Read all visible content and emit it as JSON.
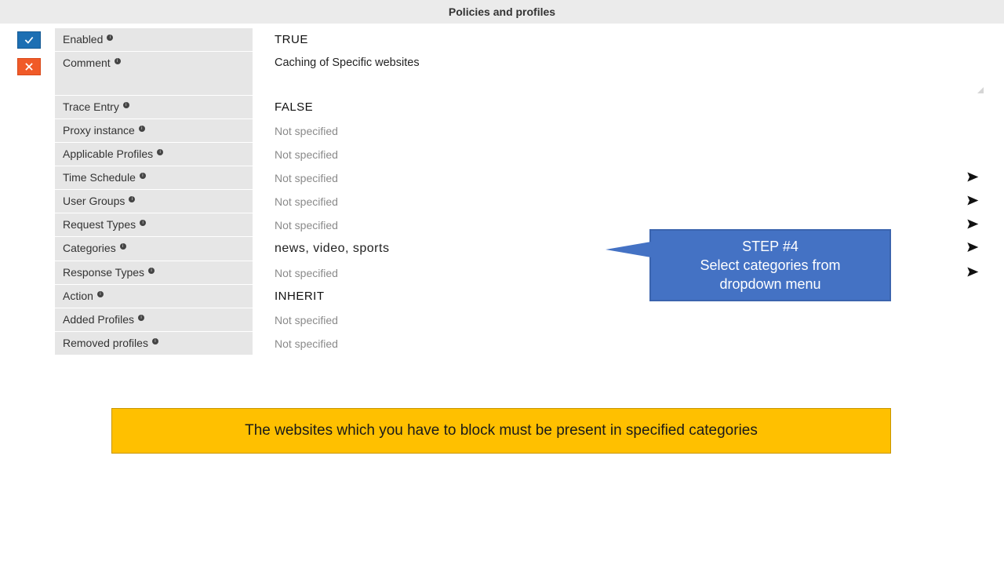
{
  "header": {
    "title": "Policies and profiles"
  },
  "sideIcons": {
    "save": "checkbox-icon",
    "cancel": "close-icon"
  },
  "rows": {
    "enabled": {
      "label": "Enabled",
      "value": "TRUE"
    },
    "comment": {
      "label": "Comment",
      "value": "Caching of Specific websites"
    },
    "traceEntry": {
      "label": "Trace Entry",
      "value": "FALSE"
    },
    "proxyInstance": {
      "label": "Proxy instance",
      "value": "Not specified"
    },
    "applicableProfiles": {
      "label": "Applicable Profiles",
      "value": "Not specified"
    },
    "timeSchedule": {
      "label": "Time Schedule",
      "value": "Not specified"
    },
    "userGroups": {
      "label": "User Groups",
      "value": "Not specified"
    },
    "requestTypes": {
      "label": "Request Types",
      "value": "Not specified"
    },
    "categories": {
      "label": "Categories",
      "value": "news,   video,   sports"
    },
    "responseTypes": {
      "label": "Response Types",
      "value": "Not specified"
    },
    "action": {
      "label": "Action",
      "value": "INHERIT"
    },
    "addedProfiles": {
      "label": "Added Profiles",
      "value": "Not specified"
    },
    "removedProfiles": {
      "label": "Removed profiles",
      "value": "Not specified"
    }
  },
  "callout": {
    "line1": "STEP #4",
    "line2": "Select categories from",
    "line3": "dropdown menu"
  },
  "note": "The websites which you have to block must be present in specified categories",
  "colors": {
    "calloutBg": "#4472c4",
    "noteBg": "#ffc000"
  }
}
